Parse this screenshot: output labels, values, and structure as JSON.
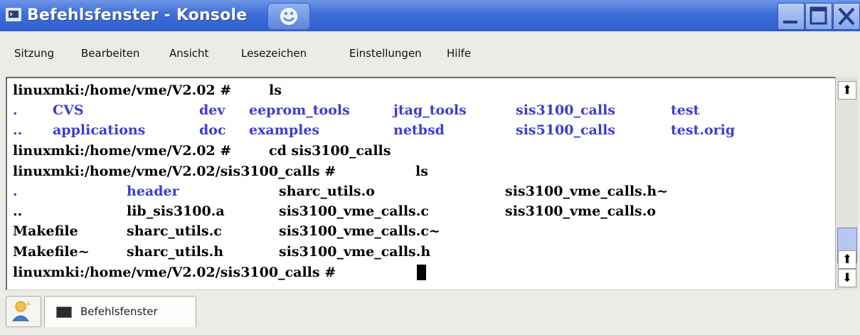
{
  "window": {
    "title": "Befehlsfenster - Konsole"
  },
  "menu": {
    "items": [
      "Sitzung",
      "Bearbeiten",
      "Ansicht",
      "Lesezeichen",
      "Einstellungen",
      "Hilfe"
    ]
  },
  "terminal": {
    "line1": {
      "prompt": "linuxmki:/home/vme/V2.02 # ",
      "cmd": "ls"
    },
    "ls1_row1": [
      ".",
      "CVS",
      "dev",
      "eeprom_tools",
      "jtag_tools",
      "sis3100_calls",
      "test"
    ],
    "ls1_row2": [
      "..",
      "applications",
      "doc",
      "examples",
      "netbsd",
      "sis5100_calls",
      "test.orig"
    ],
    "line4": {
      "prompt": "linuxmki:/home/vme/V2.02 # ",
      "cmd": "cd sis3100_calls"
    },
    "line5": {
      "prompt": "linuxmki:/home/vme/V2.02/sis3100_calls # ",
      "cmd": "ls"
    },
    "ls2_row1": [
      ".",
      "header",
      "sharc_utils.o",
      "sis3100_vme_calls.h~"
    ],
    "ls2_row2": [
      "..",
      "lib_sis3100.a",
      "sis3100_vme_calls.c",
      "sis3100_vme_calls.o"
    ],
    "ls2_row3": [
      "Makefile",
      "sharc_utils.c",
      "sis3100_vme_calls.c~"
    ],
    "ls2_row4": [
      "Makefile~",
      "sharc_utils.h",
      "sis3100_vme_calls.h"
    ],
    "line10": {
      "prompt": "linuxmki:/home/vme/V2.02/sis3100_calls # "
    }
  },
  "scrollbar": {
    "up_glyph": "⬆",
    "down_glyph": "⬇",
    "top_glyph": "⬆"
  },
  "taskbar": {
    "session_label": "Befehlsfenster"
  },
  "colors": {
    "titlebar": "#3e6fd8",
    "directory": "#3c3cd9"
  }
}
